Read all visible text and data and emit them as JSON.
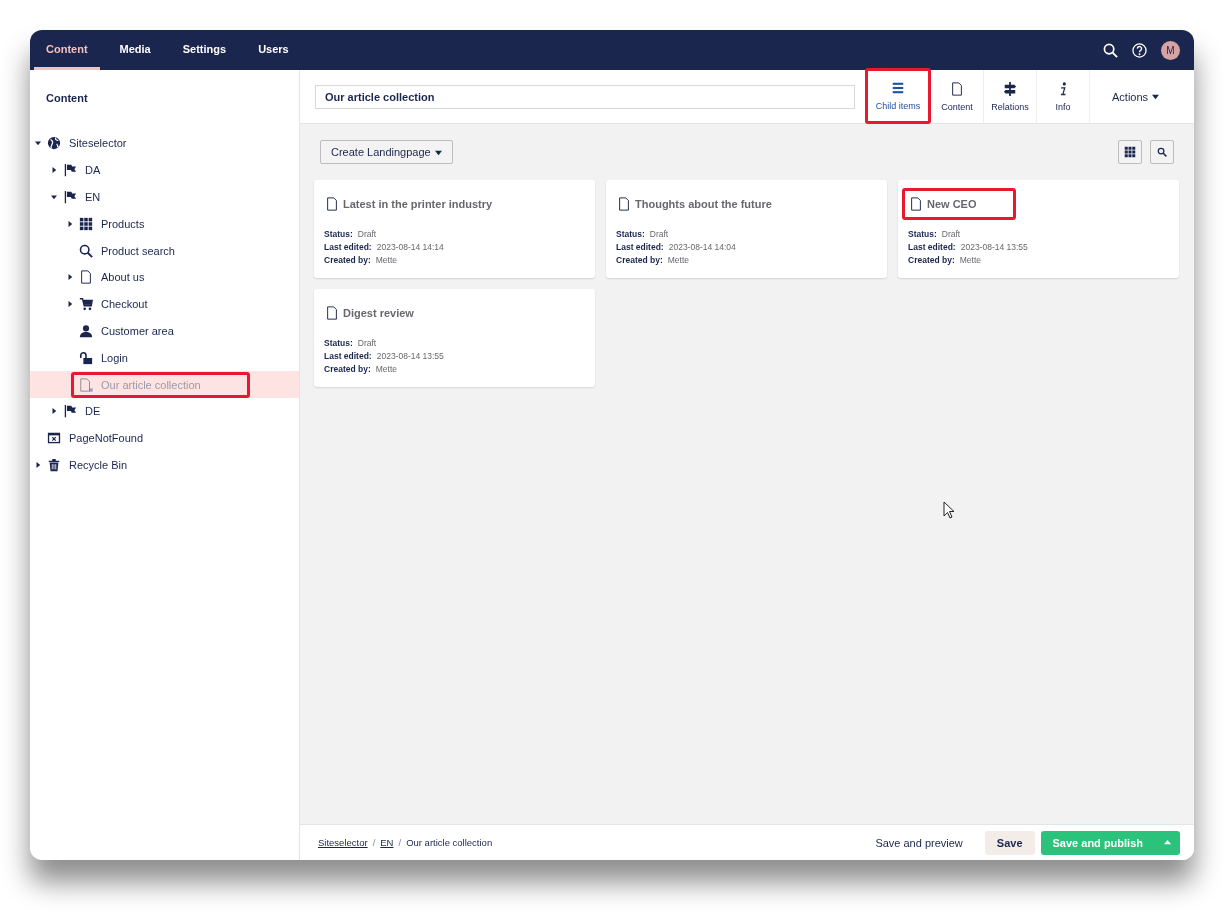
{
  "top_nav": {
    "sections": [
      {
        "label": "Content",
        "selected": true
      },
      {
        "label": "Media",
        "selected": false
      },
      {
        "label": "Settings",
        "selected": false
      },
      {
        "label": "Users",
        "selected": false
      }
    ],
    "avatar": "M"
  },
  "sidebar": {
    "title": "Content",
    "tree": [
      {
        "label": "Siteselector",
        "kind": "globe",
        "expanded": true,
        "selected": false,
        "children": [
          {
            "label": "DA",
            "kind": "flag",
            "expanded": false,
            "selected": false
          },
          {
            "label": "EN",
            "kind": "flag",
            "expanded": true,
            "selected": false,
            "children": [
              {
                "label": "Products",
                "kind": "grid",
                "expanded": false,
                "selected": false
              },
              {
                "label": "Product search",
                "kind": "search",
                "selected": false
              },
              {
                "label": "About us",
                "kind": "page",
                "expanded": false,
                "selected": false
              },
              {
                "label": "Checkout",
                "kind": "cart",
                "expanded": false,
                "selected": false
              },
              {
                "label": "Customer area",
                "kind": "user",
                "selected": false
              },
              {
                "label": "Login",
                "kind": "unlock",
                "selected": false
              },
              {
                "label": "Our article collection",
                "kind": "collection",
                "selected": true,
                "highlighted": true
              }
            ]
          },
          {
            "label": "DE",
            "kind": "flag",
            "expanded": false,
            "selected": false
          }
        ]
      },
      {
        "label": "PageNotFound",
        "kind": "error-page",
        "selected": false
      },
      {
        "label": "Recycle Bin",
        "kind": "trash",
        "expanded": false,
        "selected": false
      }
    ]
  },
  "editor": {
    "name": "Our article collection",
    "apps": [
      {
        "label": "Child items",
        "kind": "list",
        "selected": true,
        "highlighted": true
      },
      {
        "label": "Content",
        "kind": "page",
        "selected": false,
        "highlighted": false
      },
      {
        "label": "Relations",
        "kind": "signpost",
        "selected": false,
        "highlighted": false
      },
      {
        "label": "Info",
        "kind": "info",
        "selected": false,
        "highlighted": false
      }
    ],
    "actions": "Actions",
    "create_button": "Create Landingpage",
    "cards": [
      {
        "title": "Latest in the printer industry",
        "highlighted": false,
        "fields": [
          {
            "label": "Status:",
            "value": "Draft"
          },
          {
            "label": "Last edited:",
            "value": "2023-08-14 14:14"
          },
          {
            "label": "Created by:",
            "value": "Mette"
          }
        ]
      },
      {
        "title": "Thoughts about the future",
        "highlighted": false,
        "fields": [
          {
            "label": "Status:",
            "value": "Draft"
          },
          {
            "label": "Last edited:",
            "value": "2023-08-14 14:04"
          },
          {
            "label": "Created by:",
            "value": "Mette"
          }
        ]
      },
      {
        "title": "New CEO",
        "highlighted": true,
        "fields": [
          {
            "label": "Status:",
            "value": "Draft"
          },
          {
            "label": "Last edited:",
            "value": "2023-08-14 13:55"
          },
          {
            "label": "Created by:",
            "value": "Mette"
          }
        ]
      },
      {
        "title": "Digest review",
        "highlighted": false,
        "fields": [
          {
            "label": "Status:",
            "value": "Draft"
          },
          {
            "label": "Last edited:",
            "value": "2023-08-14 13:55"
          },
          {
            "label": "Created by:",
            "value": "Mette"
          }
        ]
      }
    ]
  },
  "footer": {
    "breadcrumbs": [
      {
        "label": "Siteselector",
        "link": true
      },
      {
        "label": "EN",
        "link": true
      },
      {
        "label": "Our article collection",
        "link": false
      }
    ],
    "separators": [
      "/",
      "/"
    ],
    "buttons": [
      {
        "label": "Save and preview",
        "kind": "link"
      },
      {
        "label": "Save",
        "kind": "secondary"
      },
      {
        "label": "Save and publish",
        "kind": "primary"
      }
    ]
  }
}
